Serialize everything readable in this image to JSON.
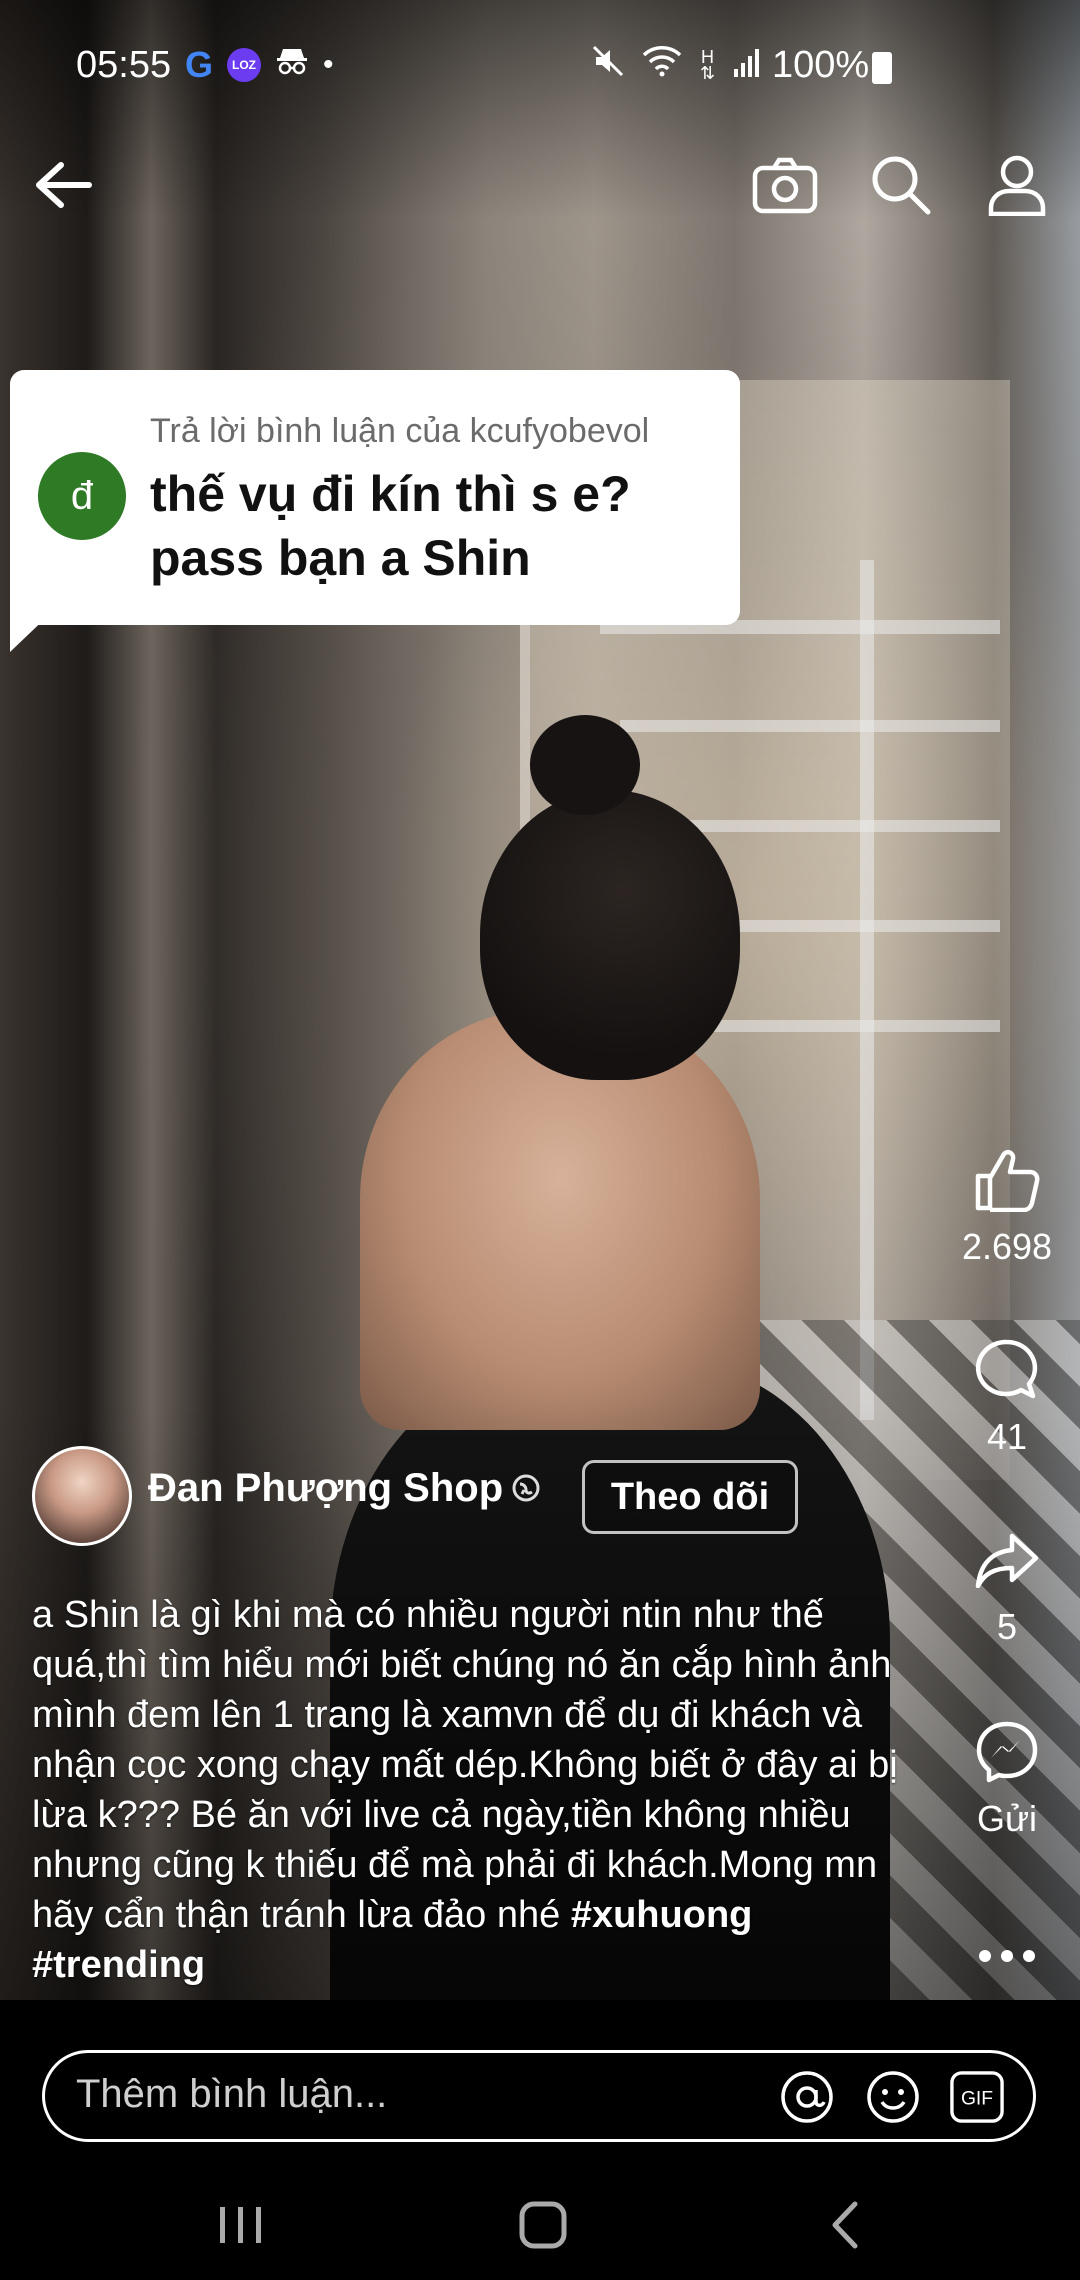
{
  "status_bar": {
    "time": "05:55",
    "left_icons": [
      "g-app-icon",
      "lazada-icon",
      "incognito-icon",
      "notification-dot-icon"
    ],
    "right_icons": [
      "mute-icon",
      "wifi-icon",
      "h-network-icon",
      "signal-icon",
      "battery-icon"
    ],
    "h_label": "H",
    "battery": "100%",
    "lazada_label": "LOZ"
  },
  "top_nav": {
    "icons": [
      "back-arrow-icon",
      "camera-icon",
      "search-icon",
      "profile-icon"
    ]
  },
  "reply_bubble": {
    "header": "Trả lời bình luận của kcufyobevol",
    "avatar_letter": "đ",
    "text_line1": "thế vụ đi kín thì s e?",
    "text_line2": "pass bạn a Shin",
    "avatar_color": "#2e7a25"
  },
  "actions": {
    "like_count": "2.698",
    "comment_count": "41",
    "share_count": "5",
    "send_label": "Gửi"
  },
  "author": {
    "name": "Đan Phượng Shop",
    "follow_label": "Theo dõi"
  },
  "caption": {
    "text": "a Shin là gì khi mà có nhiều người ntin như thế quá,thì tìm hiểu mới biết chúng nó ăn cắp hình ảnh mình đem lên 1 trang là xamvn để dụ đi khách và nhận cọc xong chạy mất dép.Không biết ở đây ai bị lừa k??? Bé ăn với live cả ngày,tiền không nhiều nhưng cũng k thiếu để mà phải đi khách.Mong mn hãy cẩn thận tránh lừa đảo nhé ",
    "hashtag1": "#xuhuong",
    "hashtag2": "#trending"
  },
  "comment_bar": {
    "placeholder": "Thêm bình luận...",
    "gif_label": "GIF"
  },
  "system_nav": {
    "icons": [
      "recents-icon",
      "home-icon",
      "back-icon"
    ]
  }
}
